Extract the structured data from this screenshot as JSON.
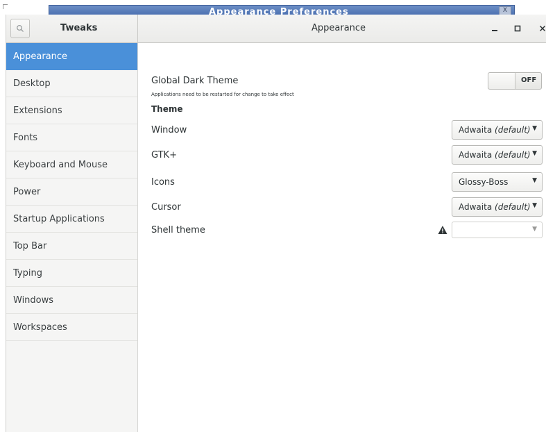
{
  "background_window": {
    "title": "Appearance Preferences",
    "close_glyph": "X"
  },
  "header": {
    "app_title": "Tweaks",
    "page_title": "Appearance",
    "search_icon": "search-icon",
    "minimize_glyph": "‒",
    "maximize_glyph": "□",
    "close_glyph": "×"
  },
  "sidebar": {
    "items": [
      {
        "label": "Appearance",
        "active": true
      },
      {
        "label": "Desktop"
      },
      {
        "label": "Extensions"
      },
      {
        "label": "Fonts"
      },
      {
        "label": "Keyboard and Mouse"
      },
      {
        "label": "Power"
      },
      {
        "label": "Startup Applications"
      },
      {
        "label": "Top Bar"
      },
      {
        "label": "Typing"
      },
      {
        "label": "Windows"
      },
      {
        "label": "Workspaces"
      }
    ]
  },
  "main": {
    "global_dark_theme": {
      "label": "Global Dark Theme",
      "switch_text": "OFF",
      "note": "Applications need to be restarted for change to take effect"
    },
    "theme_section_title": "Theme",
    "rows": {
      "window": {
        "label": "Window",
        "value": "Adwaita",
        "suffix": "(default)"
      },
      "gtk": {
        "label": "GTK+",
        "value": "Adwaita",
        "suffix": "(default)"
      },
      "icons": {
        "label": "Icons",
        "value": "Glossy-Boss",
        "suffix": ""
      },
      "cursor": {
        "label": "Cursor",
        "value": "Adwaita",
        "suffix": "(default)"
      },
      "shell": {
        "label": "Shell theme",
        "value": "",
        "suffix": ""
      }
    }
  },
  "colors": {
    "accent": "#4a90d9",
    "sidebar_bg": "#f5f5f4",
    "text": "#2e3436"
  }
}
